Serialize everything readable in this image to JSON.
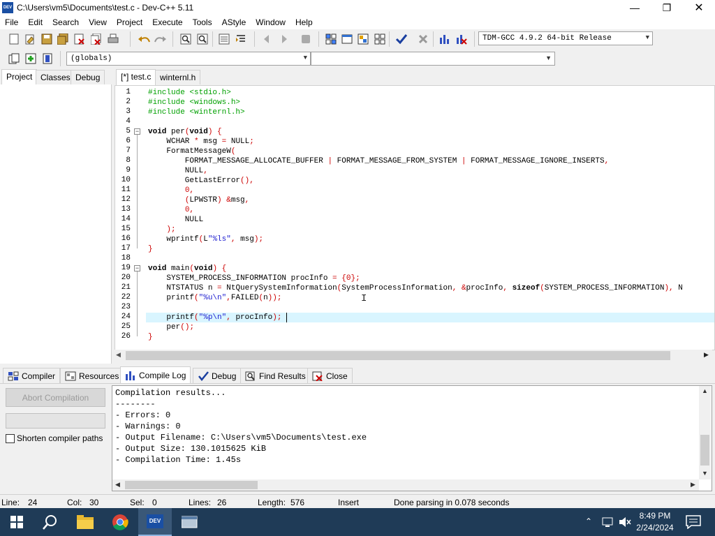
{
  "window": {
    "title": "C:\\Users\\vm5\\Documents\\test.c - Dev-C++ 5.11",
    "icon_label": "DEV"
  },
  "menu": [
    "File",
    "Edit",
    "Search",
    "View",
    "Project",
    "Execute",
    "Tools",
    "AStyle",
    "Window",
    "Help"
  ],
  "toolbar": {
    "compiler_select": "TDM-GCC 4.9.2 64-bit Release",
    "globals_select": "(globals)",
    "function_select": ""
  },
  "left_tabs": [
    "Project",
    "Classes",
    "Debug"
  ],
  "editor_tabs": [
    "[*] test.c",
    "winternl.h"
  ],
  "code_lines": [
    "#include <stdio.h>",
    "#include <windows.h>",
    "#include <winternl.h>",
    "",
    "void per(void) {",
    "    WCHAR * msg = NULL;",
    "    FormatMessageW(",
    "        FORMAT_MESSAGE_ALLOCATE_BUFFER | FORMAT_MESSAGE_FROM_SYSTEM | FORMAT_MESSAGE_IGNORE_INSERTS,",
    "        NULL,",
    "        GetLastError(),",
    "        0,",
    "        (LPWSTR) &msg,",
    "        0,",
    "        NULL",
    "    );",
    "    wprintf(L\"%ls\", msg);",
    "}",
    "",
    "void main(void) {",
    "    SYSTEM_PROCESS_INFORMATION procInfo = {0};",
    "    NTSTATUS n = NtQuerySystemInformation(SystemProcessInformation, &procInfo, sizeof(SYSTEM_PROCESS_INFORMATION), N",
    "    printf(\"%u\\n\",FAILED(n));",
    "",
    "    printf(\"%p\\n\", procInfo);",
    "    per();",
    "}"
  ],
  "line_numbers": [
    "1",
    "2",
    "3",
    "4",
    "5",
    "6",
    "7",
    "8",
    "9",
    "10",
    "11",
    "12",
    "13",
    "14",
    "15",
    "16",
    "17",
    "18",
    "19",
    "20",
    "21",
    "22",
    "23",
    "24",
    "25",
    "26"
  ],
  "bottom_tabs": [
    "Compiler",
    "Resources",
    "Compile Log",
    "Debug",
    "Find Results",
    "Close"
  ],
  "compile_panel": {
    "abort_label": "Abort Compilation",
    "shorten_label": "Shorten compiler paths"
  },
  "log_lines": [
    "Compilation results...",
    "--------",
    "- Errors: 0",
    "- Warnings: 0",
    "- Output Filename: C:\\Users\\vm5\\Documents\\test.exe",
    "- Output Size: 130.1015625 KiB",
    "- Compilation Time: 1.45s"
  ],
  "status": {
    "line_label": "Line:",
    "line": "24",
    "col_label": "Col:",
    "col": "30",
    "sel_label": "Sel:",
    "sel": "0",
    "lines_label": "Lines:",
    "lines": "26",
    "length_label": "Length:",
    "length": "576",
    "mode": "Insert",
    "message": "Done parsing in 0.078 seconds"
  },
  "taskbar": {
    "time": "8:49 PM",
    "date": "2/24/2024"
  }
}
